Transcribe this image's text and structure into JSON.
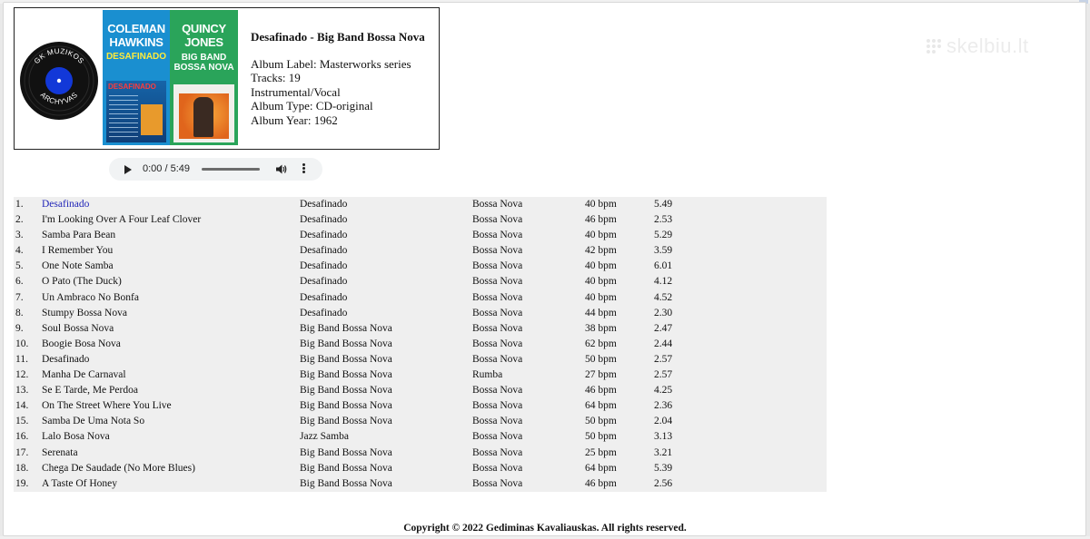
{
  "watermark": "skelbiu.lt",
  "logo": {
    "text_top": "GK MUZIKOS",
    "text_bottom": "ARCHYVAS"
  },
  "cover": {
    "left_line1": "COLEMAN",
    "left_line2": "HAWKINS",
    "left_sub": "DESAFINADO",
    "left_photo_label": "DESAFINADO",
    "right_line1": "QUINCY",
    "right_line2": "JONES",
    "right_sub1": "BIG BAND",
    "right_sub2": "BOSSA NOVA"
  },
  "album": {
    "title": "Desafinado - Big Band Bossa Nova",
    "label": "Album Label: Masterworks series",
    "tracks": "Tracks: 19",
    "kind": "Instrumental/Vocal",
    "type": "Album Type: CD-original",
    "year": "Album Year: 1962"
  },
  "player": {
    "time": "0:00 / 5:49",
    "progress_fraction": 0
  },
  "tracks": [
    {
      "num": "1.",
      "title": "Desafinado",
      "album": "Desafinado",
      "genre": "Bossa Nova",
      "bpm": "40 bpm",
      "duration": "5.49"
    },
    {
      "num": "2.",
      "title": "I'm Looking Over A Four Leaf Clover",
      "album": "Desafinado",
      "genre": "Bossa Nova",
      "bpm": "46 bpm",
      "duration": "2.53"
    },
    {
      "num": "3.",
      "title": "Samba Para Bean",
      "album": "Desafinado",
      "genre": "Bossa Nova",
      "bpm": "40 bpm",
      "duration": "5.29"
    },
    {
      "num": "4.",
      "title": "I Remember You",
      "album": "Desafinado",
      "genre": "Bossa Nova",
      "bpm": "42 bpm",
      "duration": "3.59"
    },
    {
      "num": "5.",
      "title": "One Note Samba",
      "album": "Desafinado",
      "genre": "Bossa Nova",
      "bpm": "40 bpm",
      "duration": "6.01"
    },
    {
      "num": "6.",
      "title": "O Pato (The Duck)",
      "album": "Desafinado",
      "genre": "Bossa Nova",
      "bpm": "40 bpm",
      "duration": "4.12"
    },
    {
      "num": "7.",
      "title": "Un Ambraco No Bonfa",
      "album": "Desafinado",
      "genre": "Bossa Nova",
      "bpm": "40 bpm",
      "duration": "4.52"
    },
    {
      "num": "8.",
      "title": "Stumpy Bossa Nova",
      "album": "Desafinado",
      "genre": "Bossa Nova",
      "bpm": "44 bpm",
      "duration": "2.30"
    },
    {
      "num": "9.",
      "title": "Soul Bossa Nova",
      "album": "Big Band Bossa Nova",
      "genre": "Bossa Nova",
      "bpm": "38 bpm",
      "duration": "2.47"
    },
    {
      "num": "10.",
      "title": "Boogie Bosa Nova",
      "album": "Big Band Bossa Nova",
      "genre": "Bossa Nova",
      "bpm": "62 bpm",
      "duration": "2.44"
    },
    {
      "num": "11.",
      "title": "Desafinado",
      "album": "Big Band Bossa Nova",
      "genre": "Bossa Nova",
      "bpm": "50 bpm",
      "duration": "2.57"
    },
    {
      "num": "12.",
      "title": "Manha De Carnaval",
      "album": "Big Band Bossa Nova",
      "genre": "Rumba",
      "bpm": "27 bpm",
      "duration": "2.57"
    },
    {
      "num": "13.",
      "title": "Se E Tarde, Me Perdoa",
      "album": "Big Band Bossa Nova",
      "genre": "Bossa Nova",
      "bpm": "46 bpm",
      "duration": "4.25"
    },
    {
      "num": "14.",
      "title": "On The Street Where You Live",
      "album": "Big Band Bossa Nova",
      "genre": "Bossa Nova",
      "bpm": "64 bpm",
      "duration": "2.36"
    },
    {
      "num": "15.",
      "title": "Samba De Uma Nota So",
      "album": "Big Band Bossa Nova",
      "genre": "Bossa Nova",
      "bpm": "50 bpm",
      "duration": "2.04"
    },
    {
      "num": "16.",
      "title": "Lalo Bosa Nova",
      "album": "Jazz Samba",
      "genre": "Bossa Nova",
      "bpm": "50 bpm",
      "duration": "3.13"
    },
    {
      "num": "17.",
      "title": "Serenata",
      "album": "Big Band Bossa Nova",
      "genre": "Bossa Nova",
      "bpm": "25 bpm",
      "duration": "3.21"
    },
    {
      "num": "18.",
      "title": "Chega De Saudade (No More Blues)",
      "album": "Big Band Bossa Nova",
      "genre": "Bossa Nova",
      "bpm": "64 bpm",
      "duration": "5.39"
    },
    {
      "num": "19.",
      "title": "A Taste Of Honey",
      "album": "Big Band Bossa Nova",
      "genre": "Bossa Nova",
      "bpm": "46 bpm",
      "duration": "2.56"
    }
  ],
  "footer": "Copyright © 2022 Gediminas Kavaliauskas. All rights reserved.",
  "colors": {
    "link": "#2226b8",
    "table_bg": "#efefef",
    "cover_left": "#1a8fd0",
    "cover_right": "#2aa45a",
    "record_label": "#1238d8"
  }
}
